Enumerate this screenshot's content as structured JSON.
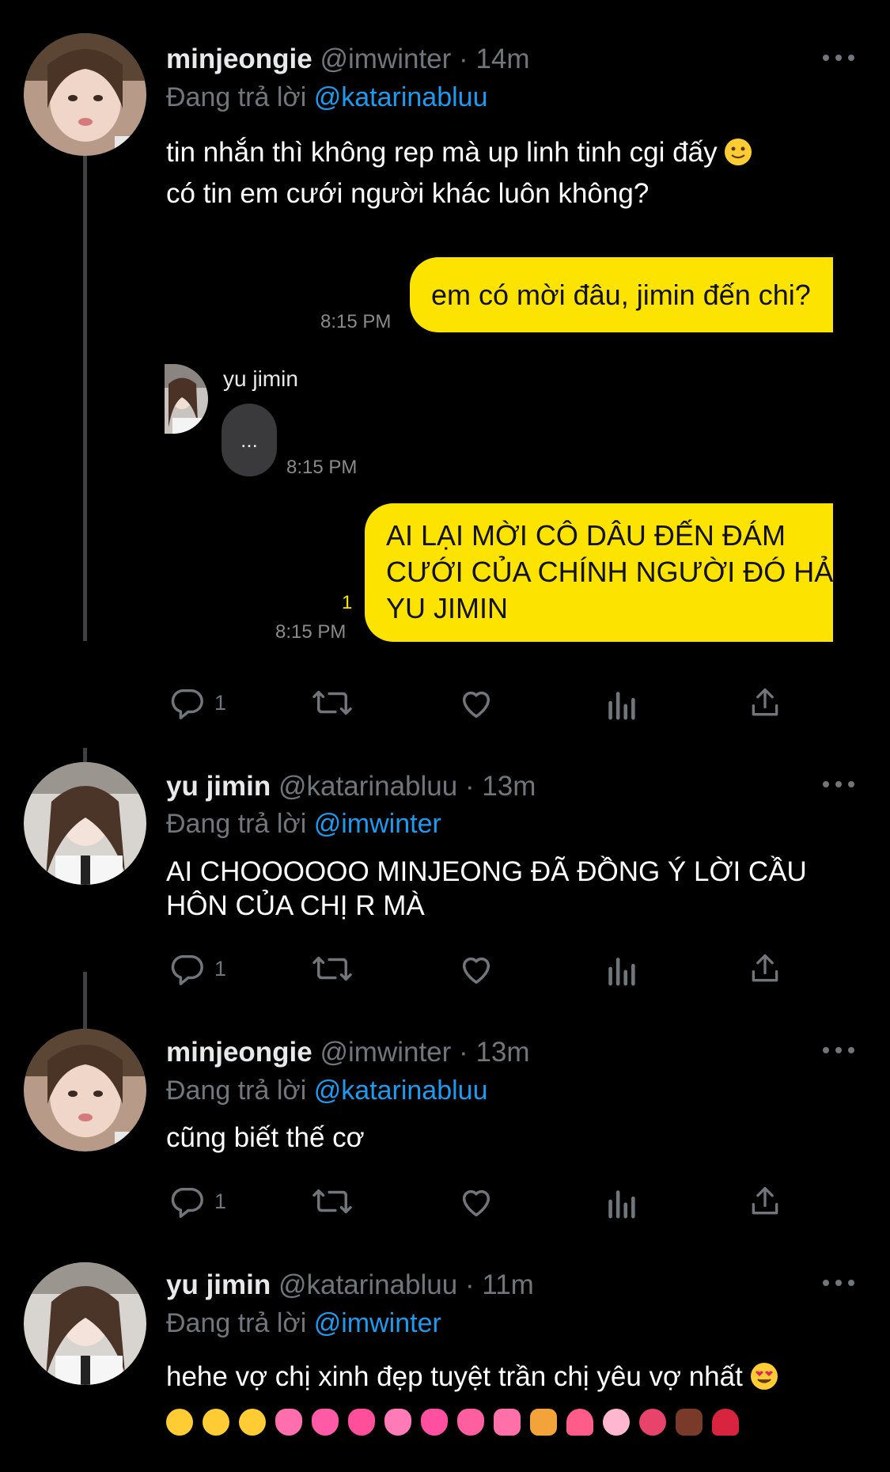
{
  "tweets": [
    {
      "display_name": "minjeongie",
      "handle": "@imwinter",
      "time": "14m",
      "replying_prefix": "Đang trả lời",
      "replying_to": "@katarinabluu",
      "text_line1": "tin nhắn thì không rep mà up linh tinh cgi đấy",
      "text_line2": "có tin em cưới người khác luôn không?",
      "reply_count": "1",
      "chat": {
        "msg1": "em có mời đâu, jimin đến chi?",
        "msg1_time": "8:15 PM",
        "other_name": "yu jimin",
        "typing": "...",
        "typing_time": "8:15 PM",
        "msg2_line1": "AI LẠI MỜI CÔ DÂU ĐẾN ĐÁM",
        "msg2_line2": "CƯỚI CỦA CHÍNH NGƯỜI ĐÓ HẢ",
        "msg2_line3": "YU JIMIN",
        "msg2_read": "1",
        "msg2_time": "8:15 PM"
      }
    },
    {
      "display_name": "yu jimin",
      "handle": "@katarinabluu",
      "time": "13m",
      "replying_prefix": "Đang trả lời",
      "replying_to": "@imwinter",
      "text_line1": "AI CHOOOOOO MINJEONG ĐÃ ĐỒNG Ý LỜI CẦU",
      "text_line2": "HÔN CỦA CHỊ R MÀ",
      "reply_count": "1"
    },
    {
      "display_name": "minjeongie",
      "handle": "@imwinter",
      "time": "13m",
      "replying_prefix": "Đang trả lời",
      "replying_to": "@katarinabluu",
      "text_line1": "cũng biết thế cơ",
      "reply_count": "1"
    },
    {
      "display_name": "yu jimin",
      "handle": "@katarinabluu",
      "time": "11m",
      "replying_prefix": "Đang trả lời",
      "replying_to": "@imwinter",
      "text_line1": "hehe vợ chị xinh đẹp tuyệt trần chị yêu vợ nhất"
    }
  ],
  "colors": {
    "background": "#000000",
    "text": "#ffffff",
    "muted": "#71767b",
    "mention": "#1d9bf0",
    "bubble": "#fde300"
  },
  "icons": [
    "reply-icon",
    "retweet-icon",
    "like-icon",
    "views-icon",
    "share-icon",
    "more-icon"
  ]
}
